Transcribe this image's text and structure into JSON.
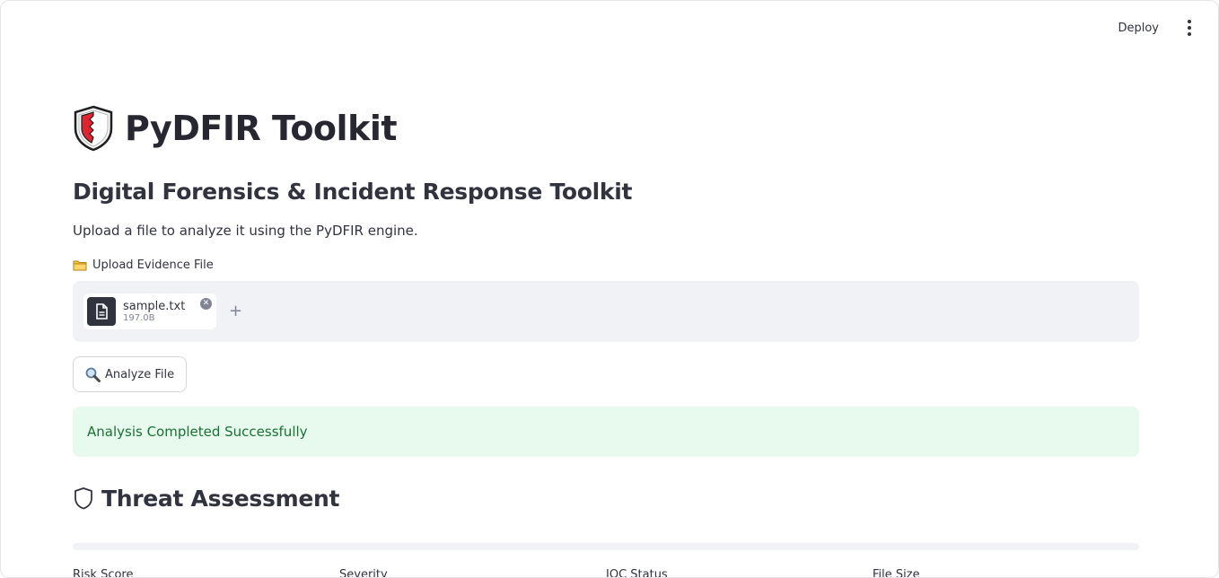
{
  "header": {
    "deploy_label": "Deploy"
  },
  "app": {
    "title": "PyDFIR Toolkit",
    "subtitle": "Digital Forensics & Incident Response Toolkit",
    "description": "Upload a file to analyze it using the PyDFIR engine."
  },
  "upload": {
    "label": "Upload Evidence File",
    "file": {
      "name": "sample.txt",
      "size": "197.0B"
    },
    "add_symbol": "+"
  },
  "actions": {
    "analyze_label": "Analyze File"
  },
  "status": {
    "message": "Analysis Completed Successfully"
  },
  "threat": {
    "section_title": "Threat Assessment",
    "progress": 0,
    "metrics": [
      "Risk Score",
      "Severity",
      "IOC Status",
      "File Size"
    ]
  },
  "icons": {
    "logo": "shield-icon",
    "upload": "folder-icon",
    "file": "document-icon",
    "analyze": "magnifier-icon",
    "section": "shield-outline-icon",
    "menu": "kebab-menu-icon",
    "remove": "close-circle-icon"
  },
  "colors": {
    "text": "#31333f",
    "shield_red": "#e1252f",
    "success_bg": "#e8f9ee",
    "success_text": "#177233",
    "dropzone_bg": "#f0f2f6"
  }
}
